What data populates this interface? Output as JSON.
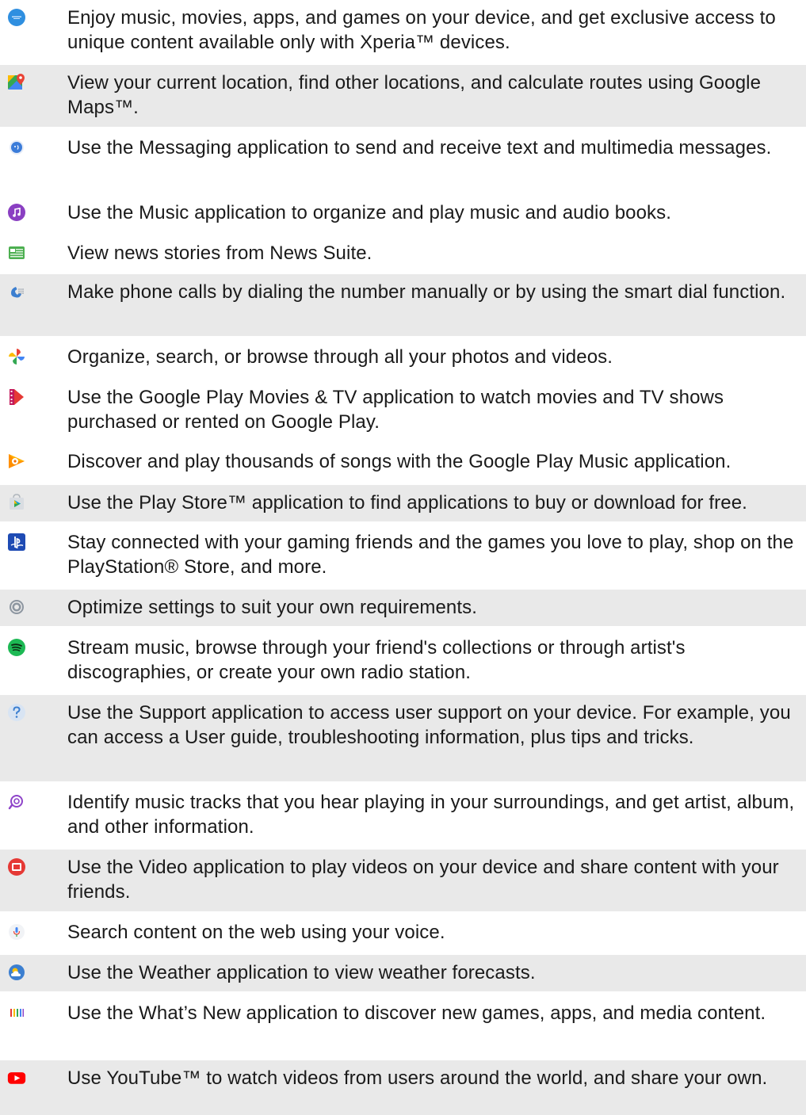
{
  "apps": [
    {
      "icon": "xperia-lounge-icon",
      "description": "Enjoy music, movies, apps, and games on your device, and get exclusive access to unique content available only with Xperia™ devices."
    },
    {
      "icon": "google-maps-icon",
      "description": "View your current location, find other locations, and calculate routes using Google Maps™."
    },
    {
      "icon": "messaging-icon",
      "description": "Use the Messaging application to send and receive text and multimedia messages."
    },
    {
      "icon": "music-icon",
      "description": "Use the Music application to organize and play music and audio books."
    },
    {
      "icon": "news-suite-icon",
      "description": "View news stories from News Suite."
    },
    {
      "icon": "phone-icon",
      "description": "Make phone calls by dialing the number manually or by using the smart dial function."
    },
    {
      "icon": "google-photos-icon",
      "description": "Organize, search, or browse through all your photos and videos."
    },
    {
      "icon": "play-movies-icon",
      "description": "Use the Google Play Movies & TV application to watch movies and TV shows purchased or rented on Google Play."
    },
    {
      "icon": "play-music-icon",
      "description": "Discover and play thousands of songs with the Google Play Music application."
    },
    {
      "icon": "play-store-icon",
      "description": "Use the Play Store™ application to find applications to buy or download for free."
    },
    {
      "icon": "playstation-icon",
      "description": "Stay connected with your gaming friends and the games you love to play, shop on the PlayStation® Store, and more."
    },
    {
      "icon": "settings-icon",
      "description": "Optimize settings to suit your own requirements."
    },
    {
      "icon": "spotify-icon",
      "description": "Stream music, browse through your friend's collections or through artist's discographies, or create your own radio station."
    },
    {
      "icon": "support-icon",
      "description": "Use the Support application to access user support on your device. For example, you can access a User guide, troubleshooting information, plus tips and tricks."
    },
    {
      "icon": "trackid-icon",
      "description": "Identify music tracks that you hear playing in your surroundings, and get artist, album, and other information."
    },
    {
      "icon": "video-icon",
      "description": "Use the Video application to play videos on your device and share content with your friends."
    },
    {
      "icon": "voice-search-icon",
      "description": "Search content on the web using your voice."
    },
    {
      "icon": "weather-icon",
      "description": "Use the Weather application to view weather forecasts."
    },
    {
      "icon": "whats-new-icon",
      "description": "Use the What’s New application to discover new games, apps, and media content."
    },
    {
      "icon": "youtube-icon",
      "description": "Use YouTube™ to watch videos from users around the world, and share your own."
    }
  ],
  "colors": {
    "row_shade": "#e9e9e9",
    "text": "#1a1a1a"
  }
}
